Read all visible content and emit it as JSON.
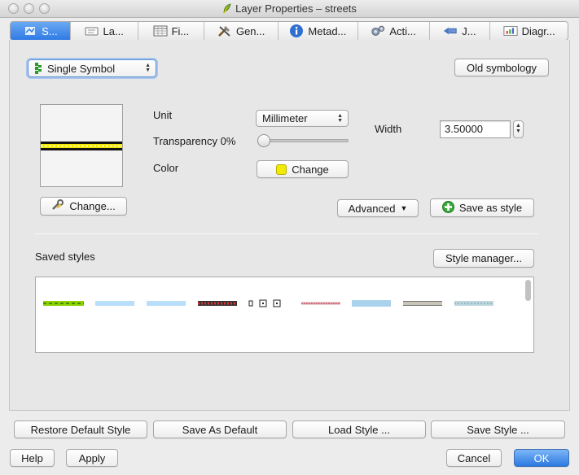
{
  "window": {
    "title": "Layer Properties – streets"
  },
  "tabs": [
    {
      "label": "S...",
      "icon": "style-icon",
      "active": true
    },
    {
      "label": "La...",
      "icon": "labels-icon",
      "active": false
    },
    {
      "label": "Fi...",
      "icon": "fields-table-icon",
      "active": false
    },
    {
      "label": "Gen...",
      "icon": "tools-icon",
      "active": false
    },
    {
      "label": "Metad...",
      "icon": "info-icon",
      "active": false
    },
    {
      "label": "Acti...",
      "icon": "gears-icon",
      "active": false
    },
    {
      "label": "J...",
      "icon": "join-icon",
      "active": false
    },
    {
      "label": "Diagr...",
      "icon": "diagram-icon",
      "active": false
    }
  ],
  "renderer": {
    "selected": "Single Symbol",
    "old_symbology_label": "Old symbology"
  },
  "symbol": {
    "unit_label": "Unit",
    "unit_value": "Millimeter",
    "transparency_label": "Transparency 0%",
    "transparency_fraction": 0,
    "color_label": "Color",
    "color_change_label": "Change",
    "color_value": "#f2ea00",
    "width_label": "Width",
    "width_value": "3.50000",
    "change_symbol_label": "Change...",
    "advanced_label": "Advanced",
    "save_as_style_label": "Save as style"
  },
  "saved_styles": {
    "label": "Saved styles",
    "style_manager_label": "Style manager..."
  },
  "bottom": {
    "restore_default": "Restore Default Style",
    "save_as_default": "Save As Default",
    "load_style": "Load Style ...",
    "save_style": "Save Style ...",
    "help": "Help",
    "apply": "Apply",
    "cancel": "Cancel",
    "ok": "OK"
  }
}
